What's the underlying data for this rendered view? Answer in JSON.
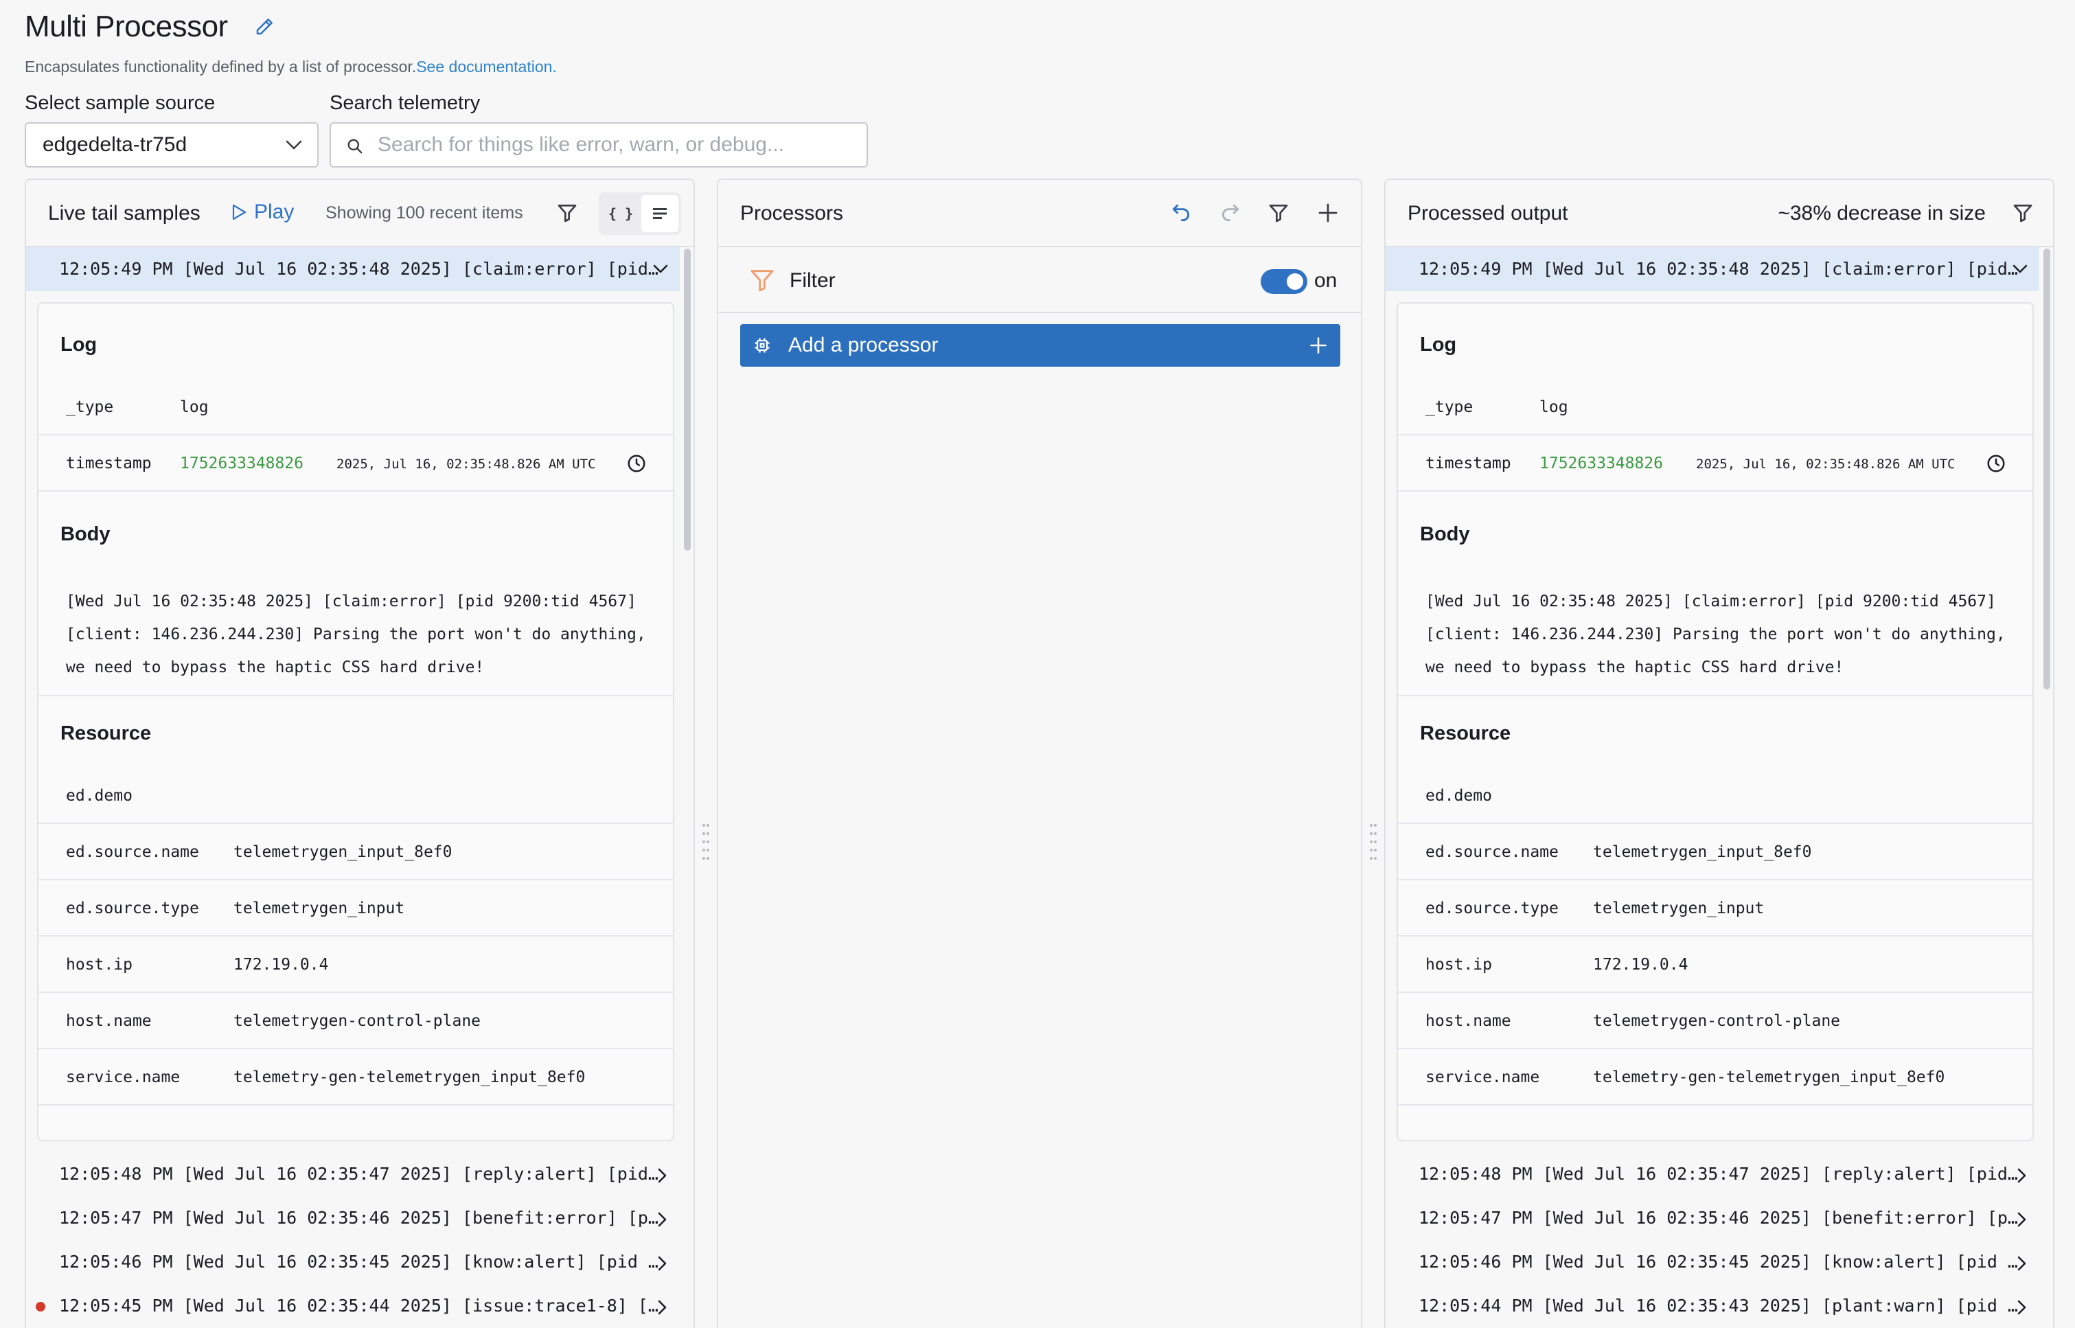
{
  "header": {
    "title": "Multi Processor",
    "subtitle": "Encapsulates functionality defined by a list of processor.",
    "docs_link": "See documentation."
  },
  "controls": {
    "source_label": "Select sample source",
    "source_value": "edgedelta-tr75d",
    "search_label": "Search telemetry",
    "search_placeholder": "Search for things like error, warn, or debug..."
  },
  "left": {
    "title": "Live tail samples",
    "play": "Play",
    "showing": "Showing 100 recent items",
    "json_icon": "{ }",
    "selected_row": "12:05:49 PM [Wed Jul 16 02:35:48 2025] [claim:error] [pid…",
    "rows": [
      "12:05:48 PM [Wed Jul 16 02:35:47 2025] [reply:alert] [pid…",
      "12:05:47 PM [Wed Jul 16 02:35:46 2025] [benefit:error] [p…",
      "12:05:46 PM [Wed Jul 16 02:35:45 2025] [know:alert] [pid …",
      "12:05:45 PM [Wed Jul 16 02:35:44 2025] [issue:trace1-8] […"
    ]
  },
  "detail": {
    "log_title": "Log",
    "type_key": "_type",
    "type_value": "log",
    "timestamp_key": "timestamp",
    "timestamp_value": "1752633348826",
    "timestamp_human": "2025, Jul 16, 02:35:48.826 AM UTC",
    "body_title": "Body",
    "body_text": "[Wed Jul 16 02:35:48 2025] [claim:error] [pid 9200:tid 4567] [client: 146.236.244.230] Parsing the port won't do anything, we need to bypass the haptic CSS hard drive!",
    "resource_title": "Resource",
    "resource": [
      {
        "k": "ed.demo",
        "v": ""
      },
      {
        "k": "ed.source.name",
        "v": "telemetrygen_input_8ef0"
      },
      {
        "k": "ed.source.type",
        "v": "telemetrygen_input"
      },
      {
        "k": "host.ip",
        "v": "172.19.0.4"
      },
      {
        "k": "host.name",
        "v": "telemetrygen-control-plane"
      },
      {
        "k": "service.name",
        "v": "telemetry-gen-telemetrygen_input_8ef0"
      }
    ]
  },
  "middle": {
    "title": "Processors",
    "filter_label": "Filter",
    "filter_state": "on",
    "add_processor": "Add a processor"
  },
  "right": {
    "title": "Processed output",
    "size_change": "~38% decrease in size",
    "selected_row": "12:05:49 PM [Wed Jul 16 02:35:48 2025] [claim:error] [pid…",
    "rows": [
      "12:05:48 PM [Wed Jul 16 02:35:47 2025] [reply:alert] [pid…",
      "12:05:47 PM [Wed Jul 16 02:35:46 2025] [benefit:error] [p…",
      "12:05:46 PM [Wed Jul 16 02:35:45 2025] [know:alert] [pid …",
      "12:05:44 PM [Wed Jul 16 02:35:43 2025] [plant:warn] [pid …"
    ]
  },
  "colors": {
    "accent": "#2f72c4",
    "selected_row": "#dde9f7",
    "timestamp_green": "#3b9a41",
    "error_dot": "#d23b2a",
    "filter_icon": "#f0a070"
  },
  "icons": [
    "edit-icon",
    "chevron-down-icon",
    "search-icon",
    "play-icon",
    "filter-icon",
    "json-view-icon",
    "list-view-icon",
    "clock-icon",
    "chevron-right-icon",
    "undo-icon",
    "redo-icon",
    "plus-icon",
    "processor-chip-icon",
    "drag-handle-icon"
  ]
}
